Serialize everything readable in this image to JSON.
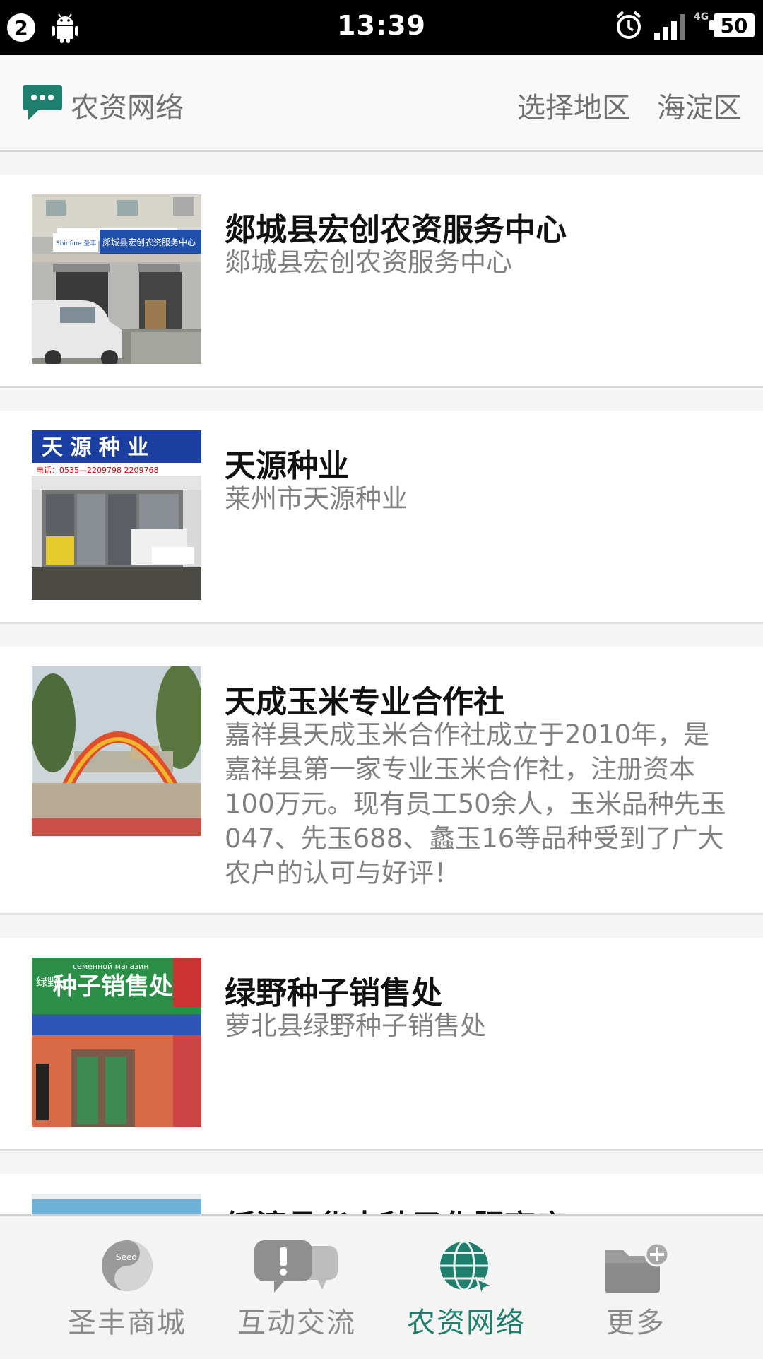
{
  "status_bar": {
    "notification_count": "2",
    "time": "13:39",
    "network": "4G",
    "battery": "50"
  },
  "header": {
    "title": "农资网络",
    "select_region_label": "选择地区",
    "current_region": "海淀区"
  },
  "list": [
    {
      "title": "郯城县宏创农资服务中心",
      "desc": "郯城县宏创农资服务中心"
    },
    {
      "title": "天源种业",
      "desc": "莱州市天源种业"
    },
    {
      "title": "天成玉米专业合作社",
      "desc": "嘉祥县天成玉米合作社成立于2010年，是嘉祥县第一家专业玉米合作社，注册资本100万元。现有员工50余人，玉米品种先玉047、先玉688、蠡玉16等品种受到了广大农户的认可与好评！"
    },
    {
      "title": "绿野种子销售处",
      "desc": "萝北县绿野种子销售处"
    },
    {
      "title": "绥滨县华丰种子化肥商店",
      "desc": ""
    }
  ],
  "thumb_texts": {
    "store1_sign": "郯城县宏创农资服务中心",
    "store1_brand": "Shinfine 圣丰",
    "store2_sign": "天 源 种 业",
    "store2_phone": "电话：0535—2209798 2209768",
    "store4_sign": "种子销售处",
    "store4_side": "绿野",
    "store4_top": "семенной магазин"
  },
  "bottom_nav": [
    {
      "label": "圣丰商城",
      "icon": "seed-logo-icon",
      "active": false
    },
    {
      "label": "互动交流",
      "icon": "chat-bubbles-icon",
      "active": false
    },
    {
      "label": "农资网络",
      "icon": "globe-icon",
      "active": true
    },
    {
      "label": "更多",
      "icon": "folder-add-icon",
      "active": false
    }
  ],
  "colors": {
    "accent": "#1e7f6d",
    "inactive": "#8a8a8a"
  }
}
